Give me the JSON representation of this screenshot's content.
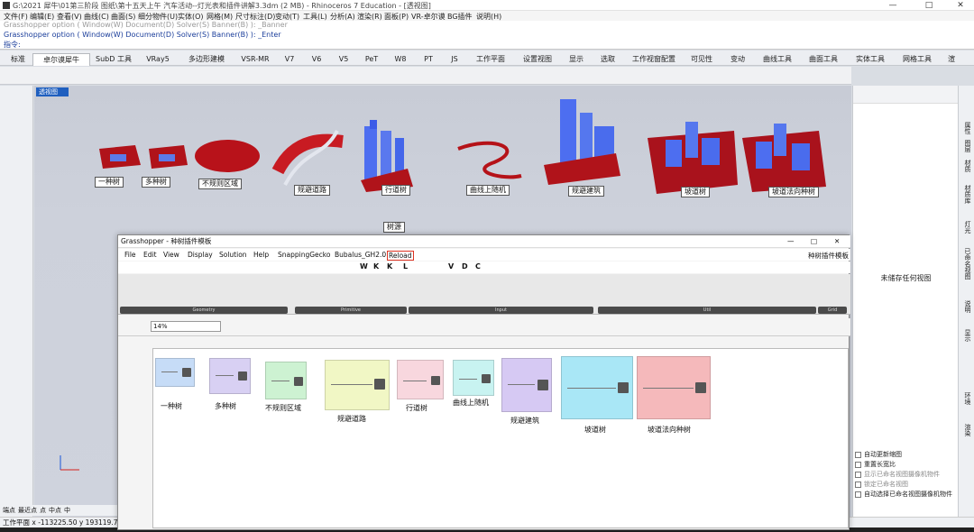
{
  "window": {
    "title": "G:\\2021 犀牛\\01第三阶段 图纸\\第十五天上午 汽车活动--灯光表和插件讲解3.3dm (2 MB) - Rhinoceros 7 Education - [透视图]",
    "minimize": "—",
    "maximize": "□",
    "close": "✕"
  },
  "menu": [
    "文件(F)",
    "编辑(E)",
    "查看(V)",
    "曲线(C)",
    "曲面(S)",
    "细分物件(U)",
    "实体(O)",
    "网格(M)",
    "尺寸标注(D)",
    "变动(T)",
    "工具(L)",
    "分析(A)",
    "渲染(R)",
    "面板(P)",
    "VR-卓尔谟",
    "BG插件",
    "说明(H)"
  ],
  "command": {
    "history": "Grasshopper option ( Window(W) Document(D) Solver(S) Banner(B) ): _Banner",
    "line": "Grasshopper option ( Window(W)  Document(D)  Solver(S)  Banner(B) ): _Enter",
    "prompt": "指令:"
  },
  "toolbar_tabs": [
    "标准",
    "卓尔谟犀牛",
    "SubD 工具",
    "VRay5",
    "多边形建模",
    "VSR-MR",
    "V7",
    "V6",
    "V5",
    "PeT",
    "W8",
    "PT",
    "JS",
    "工作平面",
    "设置视图",
    "显示",
    "选取",
    "工作视窗配置",
    "可见性",
    "变动",
    "曲线工具",
    "曲面工具",
    "实体工具",
    "网格工具",
    "渲"
  ],
  "active_tab": "卓尔谟犀牛",
  "viewport": {
    "tab": "透视图",
    "labels": [
      "一种树",
      "多种树",
      "不规则区域",
      "规避道路",
      "行道树",
      "曲线上随机",
      "规避建筑",
      "坡道树",
      "坡道法向种树",
      "树源"
    ]
  },
  "right_panel": {
    "empty_text": "未储存任何视图",
    "options": [
      {
        "label": "自动更新缩图",
        "enabled": true
      },
      {
        "label": "重置长宽比",
        "enabled": true
      },
      {
        "label": "显示已命名视图摄像机物件",
        "enabled": false
      },
      {
        "label": "锁定已命名视图",
        "enabled": false
      },
      {
        "label": "自动选择已命名视图摄像机物件",
        "enabled": true
      }
    ],
    "side_tabs": [
      "属性",
      "图层",
      "材质",
      "材质库",
      "灯光",
      "已命名视图",
      "说明",
      "显示",
      "环境",
      "渲染"
    ]
  },
  "osnap": [
    "端点",
    "最近点",
    "点",
    "中点",
    "中"
  ],
  "status": {
    "coords": "工作平面  x -113225.50  y 193119.72"
  },
  "grasshopper": {
    "title": "Grasshopper - 种树插件模板",
    "menu": [
      "File",
      "Edit",
      "View",
      "Display",
      "Solution",
      "Help",
      "SnappingGecko",
      "Bubalus_GH2.0",
      "Reload"
    ],
    "doc_name": "种树插件模板",
    "component_letters": [
      "W",
      "K",
      "K",
      "L",
      "V",
      "D",
      "C"
    ],
    "ribbon_groups": [
      "Geometry",
      "Primitive",
      "Input",
      "Util",
      "Grid"
    ],
    "zoom": "14%",
    "groups": [
      {
        "label": "一种树",
        "color": "#c6dcf7"
      },
      {
        "label": "多种树",
        "color": "#d8d0f3"
      },
      {
        "label": "不规则区域",
        "color": "#cdf2d2"
      },
      {
        "label": "规避道路",
        "color": "#f1f7c5"
      },
      {
        "label": "行道树",
        "color": "#f8d7de"
      },
      {
        "label": "曲线上随机",
        "color": "#c8f3f1"
      },
      {
        "label": "规避建筑",
        "color": "#d6c9f3"
      },
      {
        "label": "坡道树",
        "color": "#a9e7f6"
      },
      {
        "label": "坡道法向种树",
        "color": "#f5b9bb"
      }
    ],
    "window_controls": [
      "—",
      "□",
      "✕"
    ]
  }
}
